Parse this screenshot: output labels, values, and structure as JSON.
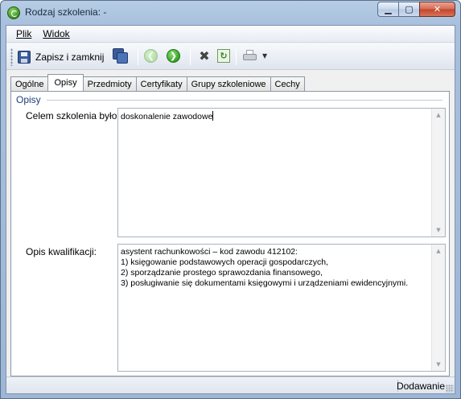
{
  "window": {
    "title": "Rodzaj szkolenia: -",
    "min_symbol": "▁",
    "max_symbol": "▢",
    "close_symbol": "✕"
  },
  "menu": {
    "file_label": "Plik",
    "view_label": "Widok"
  },
  "toolbar": {
    "save_close_label": "Zapisz i zamknij",
    "icons": [
      "save-icon",
      "save-all-icon",
      "back-icon",
      "forward-icon",
      "tools-icon",
      "refresh-icon",
      "print-icon",
      "dropdown-arrow-icon"
    ]
  },
  "tabs": [
    {
      "label": "Ogólne",
      "active": false
    },
    {
      "label": "Opisy",
      "active": true
    },
    {
      "label": "Przedmioty",
      "active": false
    },
    {
      "label": "Certyfikaty",
      "active": false
    },
    {
      "label": "Grupy szkoleniowe",
      "active": false
    },
    {
      "label": "Cechy",
      "active": false
    }
  ],
  "panel": {
    "group_title": "Opisy",
    "goal_label": "Celem szkolenia było:",
    "goal_value": "doskonalenie zawodowe",
    "qual_label": "Opis kwalifikacji:",
    "qual_value": "asystent rachunkowości – kod zawodu 412102:\n1) księgowanie podstawowych operacji gospodarczych,\n2) sporządzanie prostego sprawozdania finansowego,\n3) posługiwanie się dokumentami księgowymi i urządzeniami ewidencyjnymi."
  },
  "status": {
    "mode": "Dodawanie"
  },
  "colors": {
    "group_title": "#1f3f7a",
    "close_button": "#c2432a",
    "forward_button": "#2f9b1d"
  }
}
